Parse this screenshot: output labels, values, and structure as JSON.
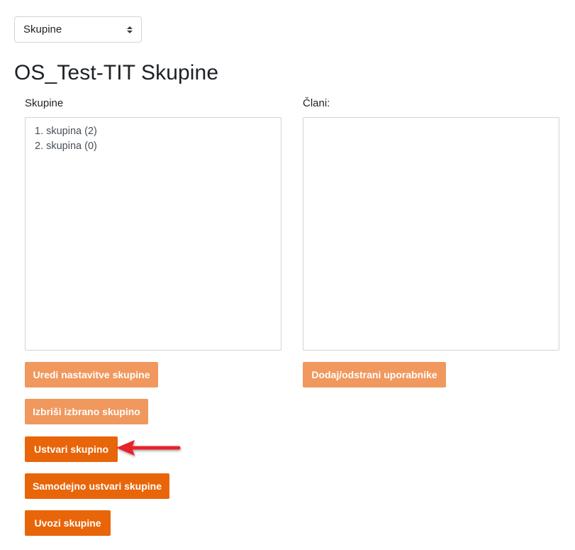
{
  "view_select": {
    "value": "Skupine"
  },
  "page_title": "OS_Test-TIT Skupine",
  "groups_panel": {
    "label": "Skupine",
    "items": [
      "1. skupina (2)",
      "2. skupina (0)"
    ]
  },
  "members_panel": {
    "label": "Člani:",
    "items": []
  },
  "buttons": {
    "edit_settings": "Uredi nastavitve skupine",
    "delete_selected": "Izbriši izbrano skupino",
    "create_group": "Ustvari skupino",
    "auto_create": "Samodejno ustvari skupine",
    "import_groups": "Uvozi skupine",
    "add_remove_users": "Dodaj/odstrani uporabnike"
  },
  "colors": {
    "button_active": "#e8650a",
    "button_disabled": "#f0985d",
    "annotation_arrow": "#e8232a"
  },
  "icons": {
    "select_caret": "sort-caret-icon",
    "annotation": "red-arrow-icon"
  }
}
